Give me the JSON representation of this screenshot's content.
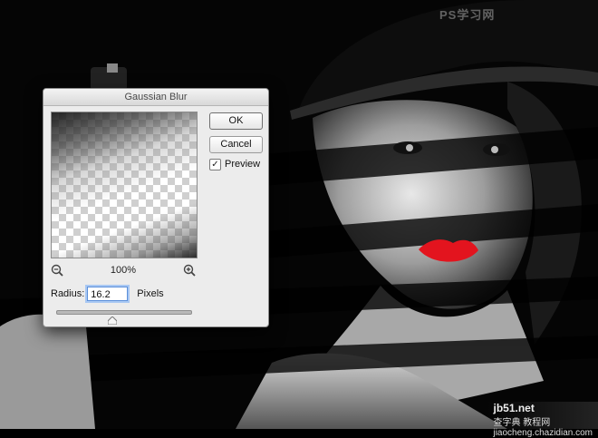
{
  "dialog": {
    "title": "Gaussian Blur",
    "ok_label": "OK",
    "cancel_label": "Cancel",
    "preview_label": "Preview",
    "preview_checked": true,
    "zoom_level": "100%",
    "zoom_out_icon": "zoom-out-icon",
    "zoom_in_icon": "zoom-in-icon",
    "radius_label": "Radius:",
    "radius_value": "16.2",
    "radius_unit": "Pixels"
  },
  "watermarks": {
    "top": "PS学习网",
    "bottom_site": "jb51.net",
    "bottom_line": "查字典 教程网",
    "bottom_url": "jiaocheng.chazidian.com"
  },
  "colors": {
    "lips": "#e3141e",
    "focus_ring": "#5b8fd9"
  }
}
